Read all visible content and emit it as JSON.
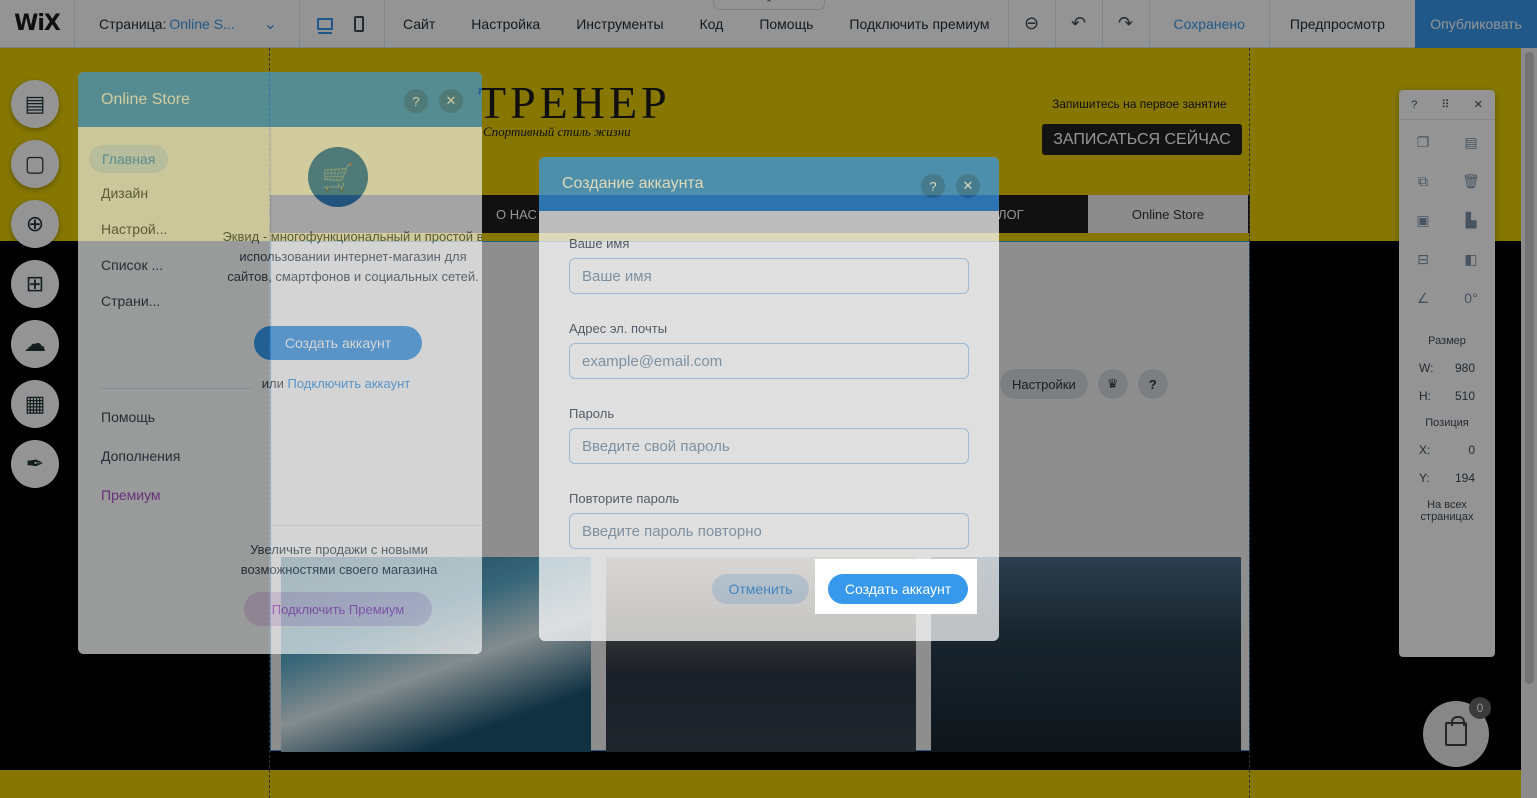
{
  "topbar": {
    "logo": "WiX",
    "page_label": "Страница:",
    "page_value": "Online S...",
    "menu": [
      "Сайт",
      "Настройка",
      "Инструменты",
      "Код",
      "Помощь",
      "Подключить премиум"
    ],
    "saved": "Сохранено",
    "preview": "Предпросмотр",
    "publish": "Опубликовать"
  },
  "site": {
    "logo": "ТРЕНЕР",
    "tagline": "Спортивный стиль жизни",
    "signup_text": "Запишитесь на первое занятие",
    "signup_button": "ЗАПИСАТЬСЯ СЕЙЧАС",
    "nav": {
      "about": "О НАС",
      "blog": "ЛОГ",
      "store": "Online Store"
    },
    "store_toolbar": {
      "settings": "Настройки"
    },
    "cart_count": "0"
  },
  "props": {
    "size_label": "Размер",
    "w_label": "W:",
    "w_value": "980",
    "h_label": "H:",
    "h_value": "510",
    "position_label": "Позиция",
    "x_label": "X:",
    "x_value": "0",
    "y_label": "Y:",
    "y_value": "194",
    "rotation": "0°",
    "all_pages": "На всех страницах"
  },
  "store_panel": {
    "title": "Online Store",
    "nav": [
      "Главная",
      "Дизайн",
      "Настрой...",
      "Список ...",
      "Страни..."
    ],
    "nav2": [
      "Помощь",
      "Дополнения",
      "Премиум"
    ],
    "description": "Эквид - многофункциональный и простой в использовании интернет-магазин для сайтов, смартфонов и социальных сетей.",
    "create_button": "Создать аккаунт",
    "or_text": "или",
    "connect_link": "Подключить аккаунт",
    "upsell": "Увеличьте продажи с новыми возможностями своего магазина",
    "premium_button": "Подключить Премиум"
  },
  "modal": {
    "title": "Создание аккаунта",
    "name_label": "Ваше имя",
    "name_placeholder": "Ваше имя",
    "email_label": "Адрес эл. почты",
    "email_placeholder": "example@email.com",
    "password_label": "Пароль",
    "password_placeholder": "Введите свой пароль",
    "repeat_label": "Повторите пароль",
    "repeat_placeholder": "Введите пароль повторно",
    "cancel": "Отменить",
    "create": "Создать аккаунт"
  },
  "colors": {
    "accent": "#3899ec",
    "site_yellow": "#e8ce00",
    "premium": "#aa4dc8"
  }
}
